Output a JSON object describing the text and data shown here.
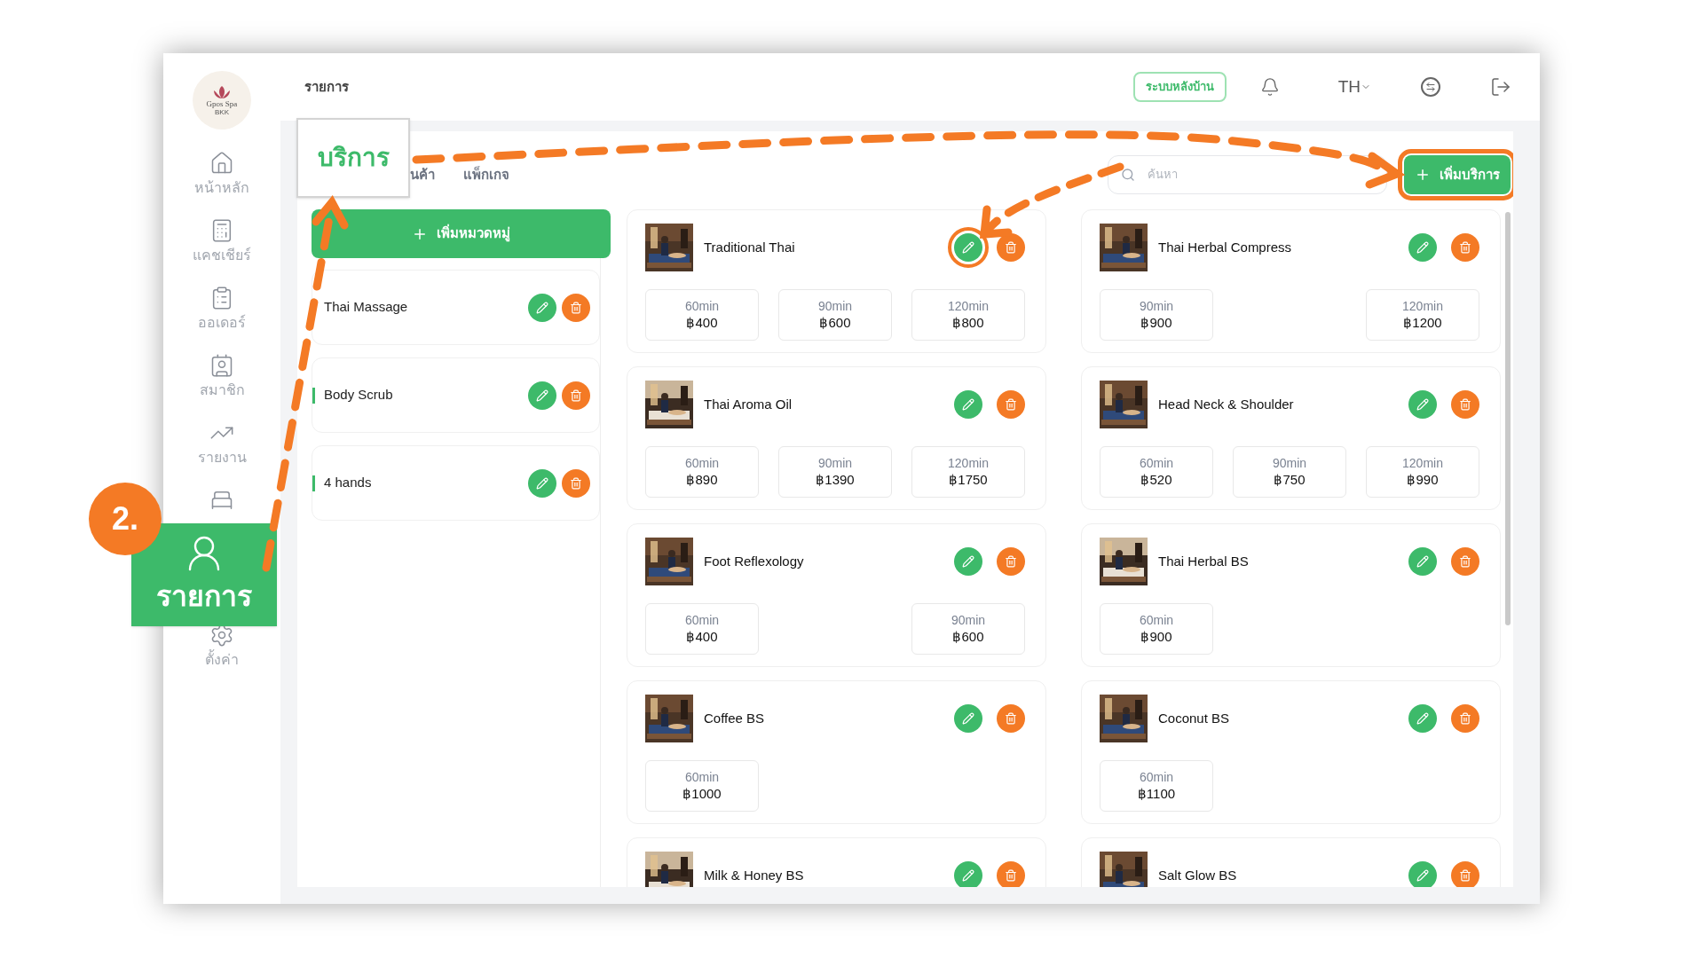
{
  "header": {
    "title": "รายการ",
    "backoffice_button": "ระบบหลังบ้าน",
    "language": "TH"
  },
  "sidebar": {
    "logo_text": "Gpos Spa",
    "logo_subtext": "BKK",
    "items": [
      {
        "kind": "home",
        "label": "หน้าหลัก"
      },
      {
        "kind": "cashier",
        "label": "แคชเชียร์"
      },
      {
        "kind": "orders",
        "label": "ออเดอร์"
      },
      {
        "kind": "members",
        "label": "สมาชิก"
      },
      {
        "kind": "reports",
        "label": "รายงาน"
      },
      {
        "kind": "tables"
      },
      {
        "kind": "settings",
        "label": "ตั้งค่า"
      }
    ]
  },
  "tabs": [
    {
      "label": "นค้า",
      "selected": false
    },
    {
      "label": "แพ็กเกจ",
      "selected": false
    }
  ],
  "search": {
    "placeholder": "ค้นหา"
  },
  "add_service_button": {
    "label": "เพิ่มบริการ",
    "highlighted": true
  },
  "add_category_button": {
    "label": "เพิ่มหมวดหมู่"
  },
  "categories": [
    {
      "name": "Thai Massage"
    },
    {
      "name": "Body Scrub"
    },
    {
      "name": "4 hands"
    }
  ],
  "services": [
    {
      "name": "Traditional Thai",
      "edit_highlighted": true,
      "prices": [
        {
          "duration": "60min",
          "price": "฿400"
        },
        {
          "duration": "90min",
          "price": "฿600"
        },
        {
          "duration": "120min",
          "price": "฿800"
        }
      ]
    },
    {
      "name": "Thai Herbal Compress",
      "edit_highlighted": false,
      "prices": [
        {
          "duration": "90min",
          "price": "฿900"
        },
        {
          "duration": "120min",
          "price": "฿1200"
        }
      ]
    },
    {
      "name": "Thai Aroma Oil",
      "edit_highlighted": false,
      "prices": [
        {
          "duration": "60min",
          "price": "฿890"
        },
        {
          "duration": "90min",
          "price": "฿1390"
        },
        {
          "duration": "120min",
          "price": "฿1750"
        }
      ]
    },
    {
      "name": "Head Neck & Shoulder",
      "edit_highlighted": false,
      "prices": [
        {
          "duration": "60min",
          "price": "฿520"
        },
        {
          "duration": "90min",
          "price": "฿750"
        },
        {
          "duration": "120min",
          "price": "฿990"
        }
      ]
    },
    {
      "name": "Foot Reflexology",
      "edit_highlighted": false,
      "prices": [
        {
          "duration": "60min",
          "price": "฿400"
        },
        {
          "duration": "90min",
          "price": "฿600"
        }
      ]
    },
    {
      "name": "Thai Herbal BS",
      "edit_highlighted": false,
      "prices": [
        {
          "duration": "60min",
          "price": "฿900"
        }
      ]
    },
    {
      "name": "Coffee BS",
      "edit_highlighted": false,
      "prices": [
        {
          "duration": "60min",
          "price": "฿1000"
        }
      ]
    },
    {
      "name": "Coconut BS",
      "edit_highlighted": false,
      "prices": [
        {
          "duration": "60min",
          "price": "฿1100"
        }
      ]
    },
    {
      "name": "Milk & Honey BS",
      "edit_highlighted": false
    },
    {
      "name": "Salt Glow BS",
      "edit_highlighted": false
    }
  ],
  "annotations": {
    "step_badge": "2.",
    "sidebar_callout": "รายการ",
    "tab_callout": "บริการ"
  }
}
